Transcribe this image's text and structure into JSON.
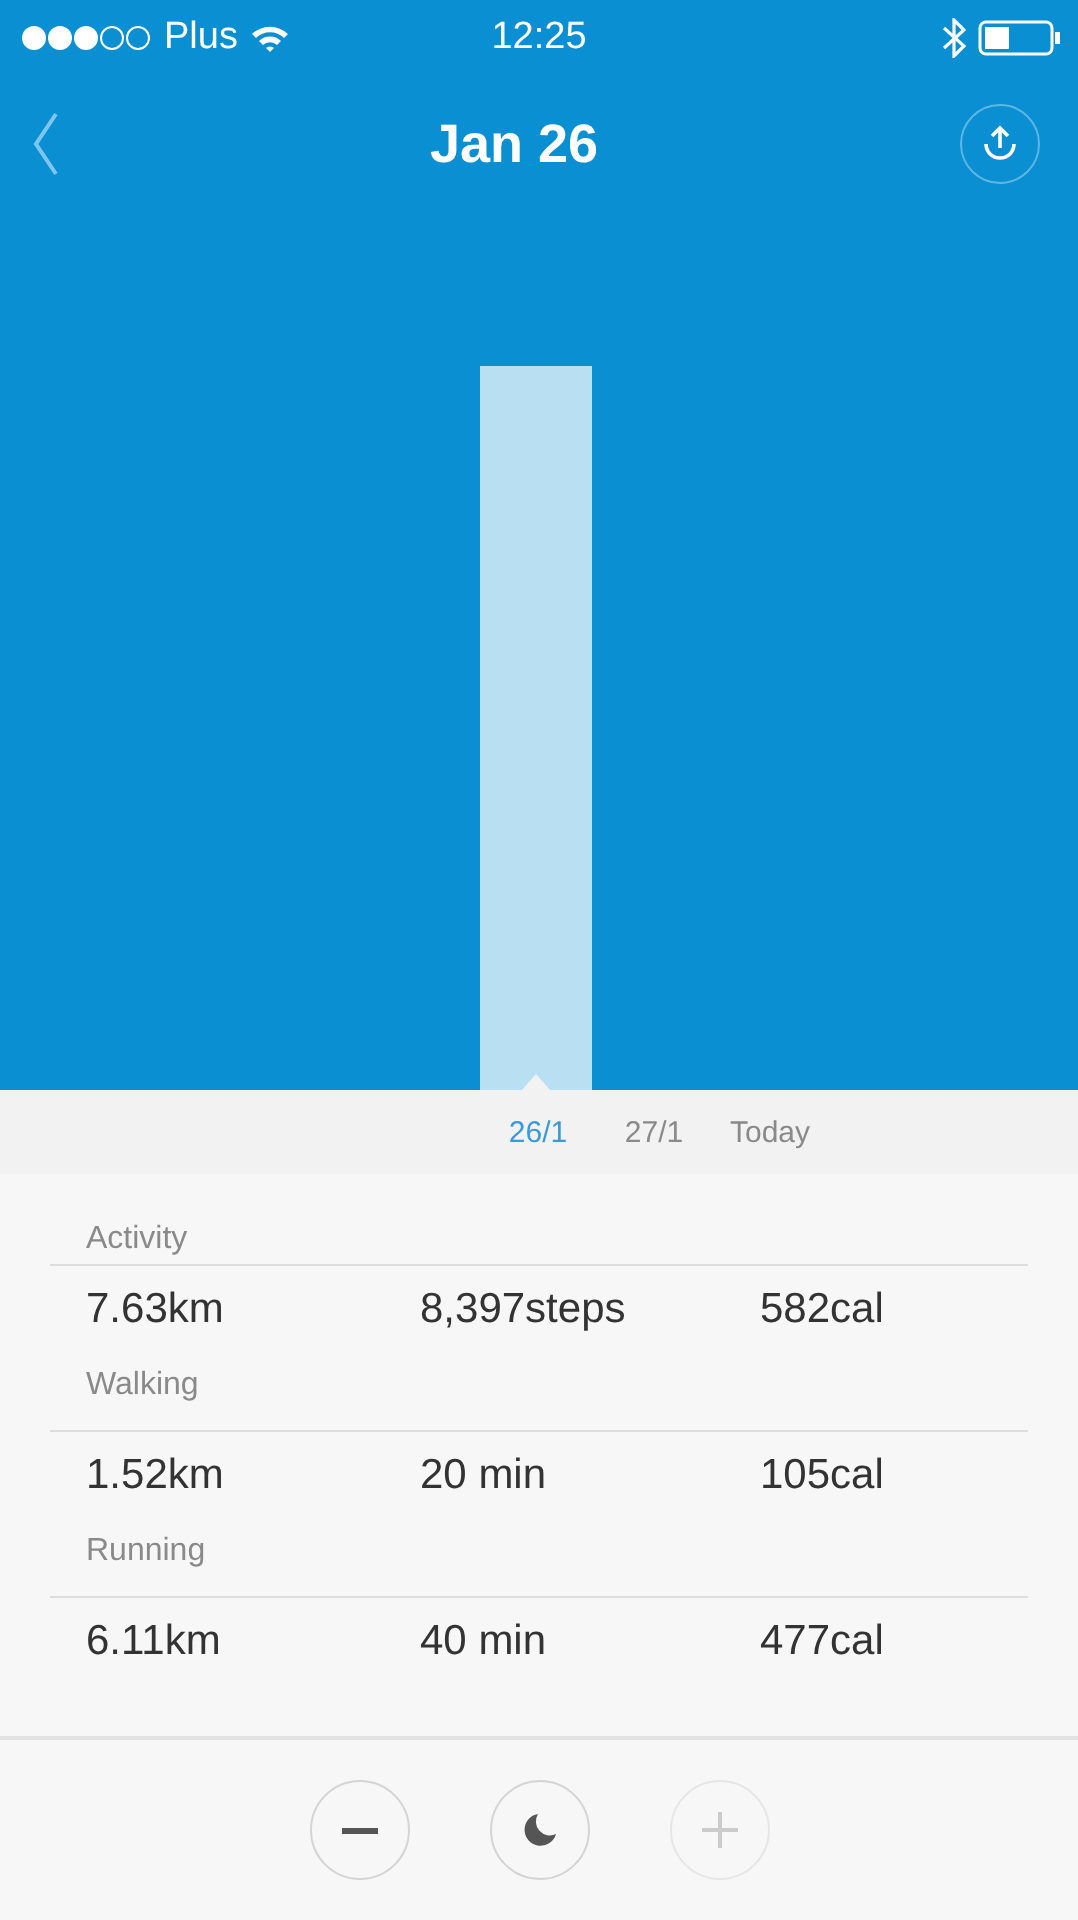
{
  "status_bar": {
    "carrier": "Plus",
    "time": "12:25"
  },
  "header": {
    "title": "Jan 26"
  },
  "days": [
    {
      "label": "26/1",
      "selected": true
    },
    {
      "label": "27/1",
      "selected": false
    },
    {
      "label": "Today",
      "selected": false
    }
  ],
  "sections": [
    {
      "title": "Activity",
      "values": [
        "7.63km",
        "8,397steps",
        "582cal"
      ]
    },
    {
      "title": "Walking",
      "values": [
        "1.52km",
        "20 min",
        "105cal"
      ]
    },
    {
      "title": "Running",
      "values": [
        "6.11km",
        "40 min",
        "477cal"
      ]
    }
  ],
  "controls": [
    {
      "kind": "minus",
      "disabled": false
    },
    {
      "kind": "moon",
      "disabled": false
    },
    {
      "kind": "plus",
      "disabled": true
    }
  ]
}
